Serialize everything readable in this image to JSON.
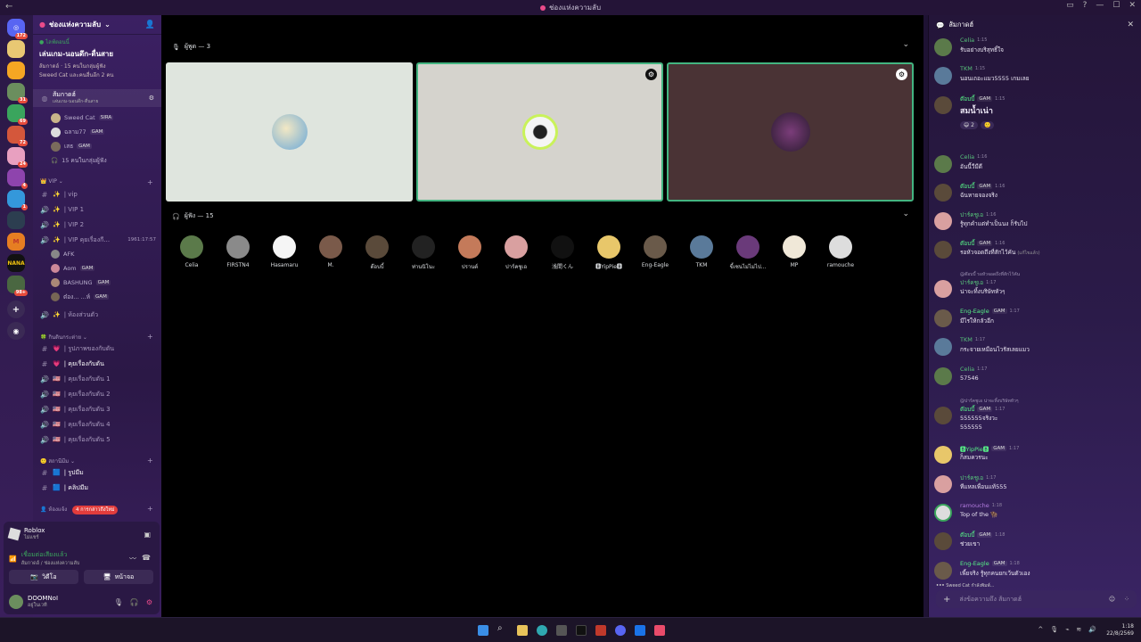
{
  "titlebar": {
    "title": "ช่องแห่งความลับ",
    "back": "←"
  },
  "server": {
    "name": "ช่องแห่งความลับ",
    "badges": [
      "172",
      "31",
      "69",
      "72",
      "24",
      "4",
      "1",
      "98+"
    ],
    "nana": "NANA"
  },
  "event": {
    "live": "● ไลฟ์ตอนนี้",
    "title": "เล่นเกม-นอนดึก-ตื่นสาย",
    "line1": "ส้มกาดฮ์ · 15 คนในกลุ่มผู้ฟัง",
    "line2": "Sweed Cat และคนอื่นอีก 2 คน"
  },
  "voice_channel": {
    "name": "ส้มกาดฮ์",
    "sub": "เล่นเกม-นอนดึก-ตื่นสาย",
    "users": [
      {
        "name": "Sweed Cat",
        "tag": "SIRA"
      },
      {
        "name": "ฉลาม77",
        "tag": "GAM"
      },
      {
        "name": "เสธ",
        "tag": "GAM"
      }
    ],
    "audience": "15 คนในกลุ่มผู้ฟัง"
  },
  "categories": {
    "vip": "VIP",
    "games": "กินดินกระต่าย",
    "meme": "สถานีมีม",
    "rooms": "ห้องแจ้ง"
  },
  "channels": {
    "vip": "| vip",
    "vip1": "| VIP 1",
    "vip2": "| VIP 2",
    "vip3": "| VIP คุยเรื่องกี...",
    "vip3_time": "1961:17:57",
    "afk": "AFK",
    "aom": "Aom",
    "bashung": "BASHUNG",
    "tone": "ต๋อง... ...ห์",
    "private": "| ห้องส่วนตัว",
    "pics": "| รูปภาพของกับดัน",
    "talk": "| คุยเรื่องกับดัน",
    "talk1": "| คุยเรื่องกับดัน 1",
    "talk2": "| คุยเรื่องกับดัน 2",
    "talk3": "| คุยเรื่องกับดัน 3",
    "talk4": "| คุยเรื่องกับดัน 4",
    "talk5": "| คุยเรื่องกับดัน 5",
    "meme1": "| รูปมีม",
    "meme2": "| คลิปมีม",
    "new_mentions": "4 การกล่าวถึงใหม่"
  },
  "voice_panel": {
    "activity": "Roblox",
    "activity_sub": "ไม่แชร์",
    "status": "เชื่อมต่อเสียงแล้ว",
    "status_sub": "ส้มกาดฮ์ / ช่องแห่งความลับ",
    "video": "วิดีโอ",
    "screen": "หน้าจอ",
    "user": "DOOMNoI",
    "user_sub": "อยู่ในเวที"
  },
  "stage": {
    "speakers_label": "ผู้พูด — 3",
    "listeners_label": "ผู้ฟัง — 15",
    "listeners": [
      "Celia",
      "FIRSTN4",
      "Hasamaru",
      "M.",
      "ต๊อบบี้",
      "ท่านนิโนะ",
      "ปรานต์",
      "ปาร์คชูเอ",
      "浅間くん",
      "🅱YipPie🅱",
      "Eng-Eagle",
      "TKM",
      "ขี้เซนไม่ไม่ไป...",
      "MP",
      "ramouche"
    ]
  },
  "chat": {
    "header": "ส้มกาดฮ์",
    "messages": [
      {
        "name": "Celia",
        "time": "1:15",
        "text": "รับอย่างบริสุทธิ์ใจ",
        "tag": ""
      },
      {
        "name": "TKM",
        "time": "1:15",
        "text": "นอนเถอะแมว5555 เกมเลย",
        "tag": ""
      },
      {
        "name": "ต๊อบบี้",
        "time": "1:15",
        "text": "สมน้ำเน่า",
        "tag": "GAM"
      },
      {
        "name": "Celia",
        "time": "1:16",
        "text": "อันนี้วีมีดี",
        "tag": ""
      },
      {
        "name": "ต๊อบบี้",
        "time": "1:16",
        "text": "ฉันหายจองจริง",
        "tag": "GAM"
      },
      {
        "name": "ปาร์คชูเอ",
        "time": "1:16",
        "text": "รู้ทุกคำแต่ทำเป็นนง ก็รับไป",
        "tag": ""
      },
      {
        "name": "ต๊อบบี้",
        "time": "1:16",
        "text": "รอหัวจอดถึงที่สักไว้คัน",
        "tag": "GAM",
        "edited": "(แก้ไขแล้ว)"
      },
      {
        "name": "ปาร์คชูเอ",
        "time": "1:17",
        "text": "น่าจะทิ้งบริษัทหัวๆ",
        "tag": "",
        "reply": "@ต๊อบบี้ รอหัวจอดถึงที่สักไว้คัน"
      },
      {
        "name": "Eng-Eagle",
        "time": "1:17",
        "text": "มีไรให้กลัวอีก",
        "tag": "GAM"
      },
      {
        "name": "TKM",
        "time": "1:17",
        "text": "กระจายเหมือนไวรัสเลยแมว",
        "tag": ""
      },
      {
        "name": "Celia",
        "time": "1:17",
        "text": "57546",
        "tag": ""
      },
      {
        "name": "ต๊อบบี้",
        "time": "1:17",
        "text": "555555จริงวะ",
        "text2": "555555",
        "tag": "GAM",
        "reply": "@ปาร์คชูเอ น่าจะทิ้งบริษัทหัวๆ"
      },
      {
        "name": "🅱YipPie🅱",
        "time": "1:17",
        "text": "ก็สมควรนะ",
        "tag": "GAM"
      },
      {
        "name": "ปาร์คชูเอ",
        "time": "1:17",
        "text": "ทีแหลเพื่อนแท้555",
        "tag": ""
      },
      {
        "name": "ramouche",
        "time": "1:18",
        "text": "Top of the 🦬",
        "tag": ""
      },
      {
        "name": "ต๊อบบี้",
        "time": "1:18",
        "text": "ช่วยเขา",
        "tag": "GAM"
      },
      {
        "name": "Eng-Eagle",
        "time": "1:18",
        "text": "เพี้ยจริง รู้ทุกคนยกเว้นตัวเอง",
        "tag": "GAM"
      }
    ],
    "reactions": [
      "😄 2",
      "🙂"
    ],
    "typing": "Sweed Cat กำลังพิมพ์...",
    "input_placeholder": "ส่งข้อความถึง ส้มกาดฮ์"
  },
  "tray": {
    "time": "1:18",
    "date": "22/8/2569"
  },
  "colors": {
    "accent": "#5865f2",
    "green": "#3ba55d",
    "speaking": "#43b581",
    "gam_name": "#57f287"
  }
}
